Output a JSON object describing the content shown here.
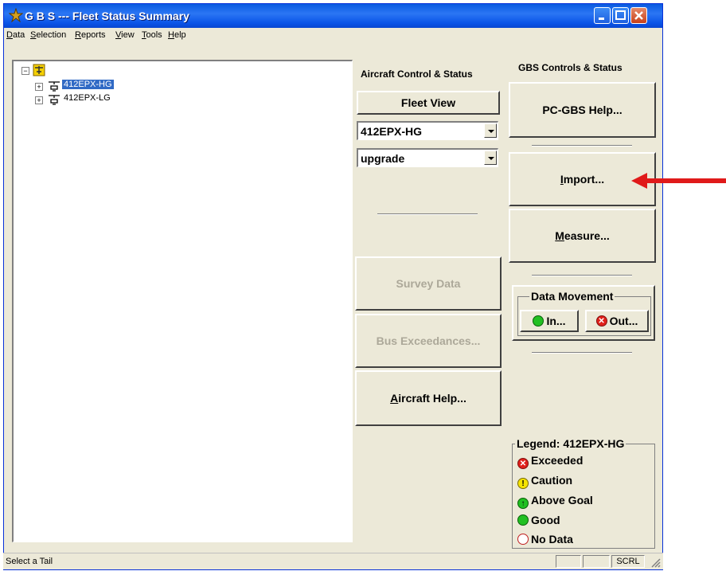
{
  "window": {
    "title": "G B S --- Fleet Status Summary"
  },
  "menu": [
    "Data",
    "Selection",
    "Reports",
    "View",
    "Tools",
    "Help"
  ],
  "tree": {
    "items": [
      "412EPX-HG",
      "412EPX-LG"
    ],
    "selected": "412EPX-HG"
  },
  "aircraft_panel": {
    "heading": "Aircraft Control & Status",
    "fleet_view": "Fleet View",
    "tail_select": "412EPX-HG",
    "mode_select": "upgrade",
    "survey_data": "Survey Data",
    "bus_exceedances": "Bus Exceedances...",
    "aircraft_help": "Aircraft Help..."
  },
  "gbs_panel": {
    "heading": "GBS Controls & Status",
    "pc_gbs_help": "PC-GBS Help...",
    "import": "Import...",
    "measure": "Measure...",
    "data_movement": {
      "title": "Data Movement",
      "in": "In...",
      "out": "Out..."
    }
  },
  "legend": {
    "title": "Legend: 412EPX-HG",
    "items": [
      {
        "label": "Exceeded",
        "icon": "x-red-icon",
        "color": "#e0201a"
      },
      {
        "label": "Caution",
        "icon": "exclamation-yellow-icon",
        "color": "#f5e400"
      },
      {
        "label": "Above Goal",
        "icon": "up-arrow-green-icon",
        "color": "#22c022"
      },
      {
        "label": "Good",
        "icon": "green-dot-icon",
        "color": "#22c022"
      },
      {
        "label": "No Data",
        "icon": "empty-circle-icon",
        "color": "#ffffff"
      }
    ]
  },
  "status": {
    "text": "Select a Tail",
    "scrl": "SCRL"
  },
  "annotation": {
    "arrow_color": "#e01a1a"
  }
}
